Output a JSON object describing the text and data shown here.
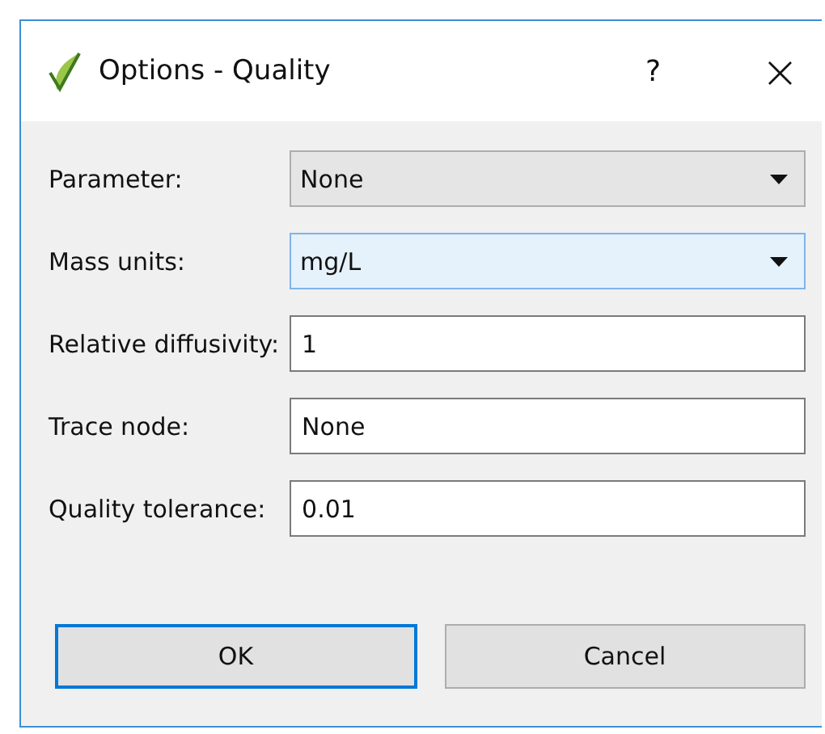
{
  "window": {
    "title": "Options - Quality",
    "help": "?",
    "close": "×"
  },
  "fields": [
    {
      "label": "Parameter:",
      "kind": "dropdown",
      "value": "None",
      "focused": false
    },
    {
      "label": "Mass units:",
      "kind": "dropdown",
      "value": "mg/L",
      "focused": true
    },
    {
      "label": "Relative diffusivity:",
      "kind": "text",
      "value": "1",
      "focused": false
    },
    {
      "label": "Trace node:",
      "kind": "text",
      "value": "None",
      "focused": false
    },
    {
      "label": "Quality tolerance:",
      "kind": "text",
      "value": "0.01",
      "focused": false
    }
  ],
  "buttons": [
    {
      "label": "OK",
      "default": true
    },
    {
      "label": "Cancel",
      "default": false
    }
  ]
}
